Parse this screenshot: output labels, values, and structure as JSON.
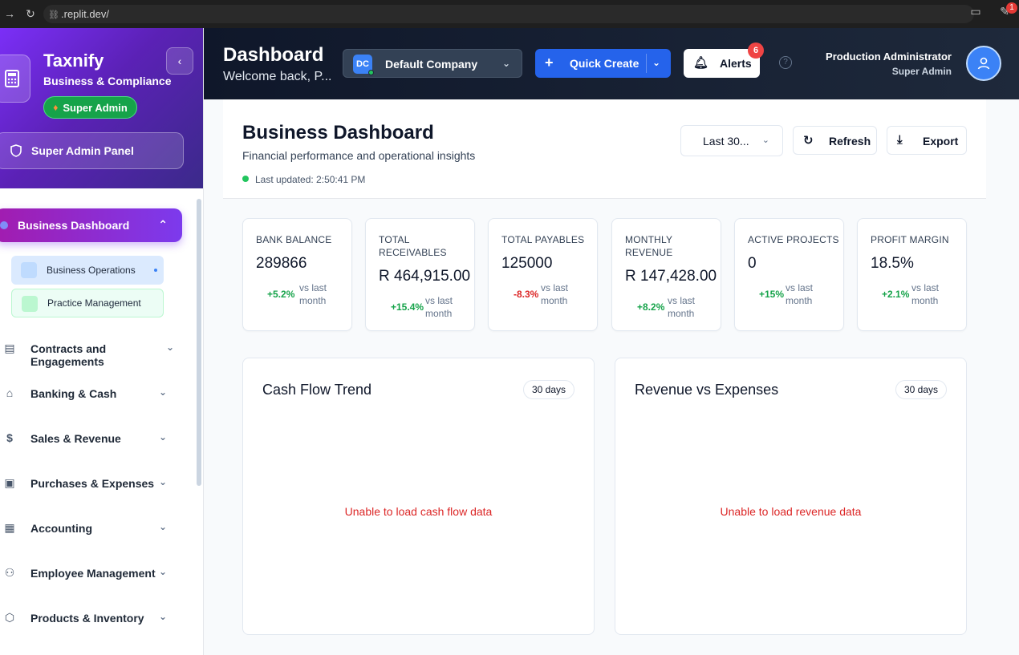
{
  "browser": {
    "url": ".replit.dev/",
    "extension_badge": "1"
  },
  "sidebar": {
    "brand": "Taxnify",
    "brand_sub": "Business & Compliance",
    "role_badge": "Super Admin",
    "admin_panel": "Super Admin Panel",
    "active_item": "Business Dashboard",
    "sub_items": [
      "Business Operations",
      "Practice Management"
    ],
    "items": [
      {
        "label": "Contracts and Engagements",
        "icon": "document-icon"
      },
      {
        "label": "Banking & Cash",
        "icon": "bank-icon"
      },
      {
        "label": "Sales & Revenue",
        "icon": "dollar-icon"
      },
      {
        "label": "Purchases & Expenses",
        "icon": "receipt-icon"
      },
      {
        "label": "Accounting",
        "icon": "calculator-icon"
      },
      {
        "label": "Employee Management",
        "icon": "users-icon"
      },
      {
        "label": "Products & Inventory",
        "icon": "box-icon"
      }
    ]
  },
  "header": {
    "title": "Dashboard",
    "welcome": "Welcome back, P...",
    "company_initials": "DC",
    "company": "Default Company",
    "quick_create": "Quick Create",
    "alerts": "Alerts",
    "alerts_count": "6",
    "help": "?",
    "user_name": "Production Administrator",
    "user_role": "Super Admin"
  },
  "main": {
    "title": "Business Dashboard",
    "subtitle": "Financial performance and operational insights",
    "last_updated": "Last updated: 2:50:41 PM",
    "range": "Last 30...",
    "refresh": "Refresh",
    "export": "Export",
    "stats": [
      {
        "title": "BANK BALANCE",
        "value": "289866",
        "change": "+5.2%",
        "trend": "up",
        "vs": "vs last month"
      },
      {
        "title": "TOTAL RECEIVABLES",
        "value": "R 464,915.00",
        "change": "+15.4%",
        "trend": "up",
        "vs": "vs last month"
      },
      {
        "title": "TOTAL PAYABLES",
        "value": "125000",
        "change": "-8.3%",
        "trend": "down",
        "vs": "vs last month"
      },
      {
        "title": "MONTHLY REVENUE",
        "value": "R 147,428.00",
        "change": "+8.2%",
        "trend": "up",
        "vs": "vs last month"
      },
      {
        "title": "ACTIVE PROJECTS",
        "value": "0",
        "change": "+15%",
        "trend": "up",
        "vs": "vs last month"
      },
      {
        "title": "PROFIT MARGIN",
        "value": "18.5%",
        "change": "+2.1%",
        "trend": "up",
        "vs": "vs last month"
      }
    ],
    "panels": [
      {
        "title": "Cash Flow Trend",
        "period": "30 days",
        "error": "Unable to load cash flow data"
      },
      {
        "title": "Revenue vs Expenses",
        "period": "30 days",
        "error": "Unable to load revenue data"
      }
    ]
  },
  "colors": {
    "accent": "#2563eb",
    "sidebar_gradient_start": "#7b2ff7",
    "header_bg": "#0f172a",
    "positive": "#16a34a",
    "negative": "#dc2626"
  }
}
